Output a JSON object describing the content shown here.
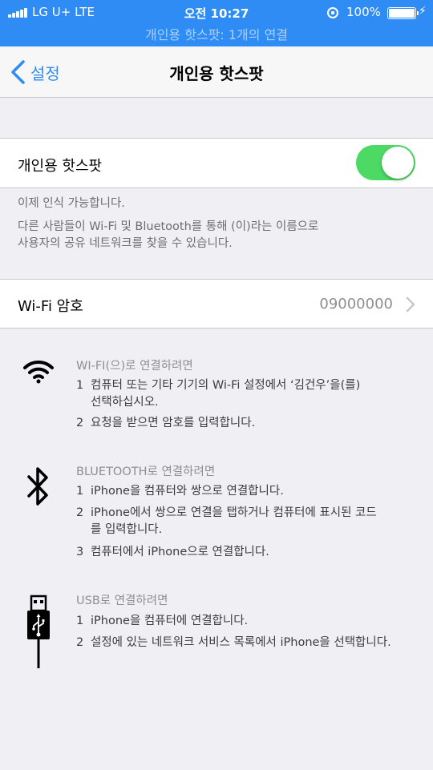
{
  "status_bar": {
    "carrier": "LG U+  LTE",
    "time": "오전 10:27",
    "battery_percent": "100%",
    "hotspot_banner": "개인용 핫스팟: 1개의 연결",
    "background_color": "#2f8cf4",
    "icons": [
      "signal-icon",
      "orientation-lock-icon",
      "battery-icon",
      "charging-icon"
    ]
  },
  "nav": {
    "back_label": "설정",
    "title": "개인용 핫스팟"
  },
  "hotspot_cell": {
    "label": "개인용 핫스팟",
    "toggle_on": true,
    "toggle_color": "#4cd964"
  },
  "notes": {
    "line1": "이제 인식 가능합니다.",
    "line2": "다른 사람들이 Wi-Fi 및 Bluetooth를 통해             (이)라는 이름으로",
    "line3": "사용자의 공유 네트워크를 찾을 수 있습니다."
  },
  "wifi_password": {
    "label": "Wi-Fi 암호",
    "value": "09000000"
  },
  "instructions": {
    "wifi": {
      "icon": "wifi-icon",
      "heading": "WI-FI(으)로 연결하려면",
      "steps": [
        {
          "num": "1",
          "text": "컴퓨터 또는 기타 기기의 Wi-Fi 설정에서 ‘김건우’을(를)",
          "cont": "선택하십시오."
        },
        {
          "num": "2",
          "text": "요청을 받으면 암호를 입력합니다."
        }
      ]
    },
    "bluetooth": {
      "icon": "bluetooth-icon",
      "heading": "BLUETOOTH로 연결하려면",
      "steps": [
        {
          "num": "1",
          "text": "iPhone을 컴퓨터와 쌍으로 연결합니다."
        },
        {
          "num": "2",
          "text": "iPhone에서 쌍으로 연결을 탭하거나 컴퓨터에 표시된 코드",
          "cont": "를 입력합니다."
        },
        {
          "num": "3",
          "text": "컴퓨터에서 iPhone으로 연결합니다."
        }
      ]
    },
    "usb": {
      "icon": "usb-icon",
      "heading": "USB로 연결하려면",
      "steps": [
        {
          "num": "1",
          "text": "iPhone을 컴퓨터에 연결합니다."
        },
        {
          "num": "2",
          "text": "설정에 있는 네트워크 서비스 목록에서 iPhone을 선택합니다."
        }
      ]
    }
  }
}
